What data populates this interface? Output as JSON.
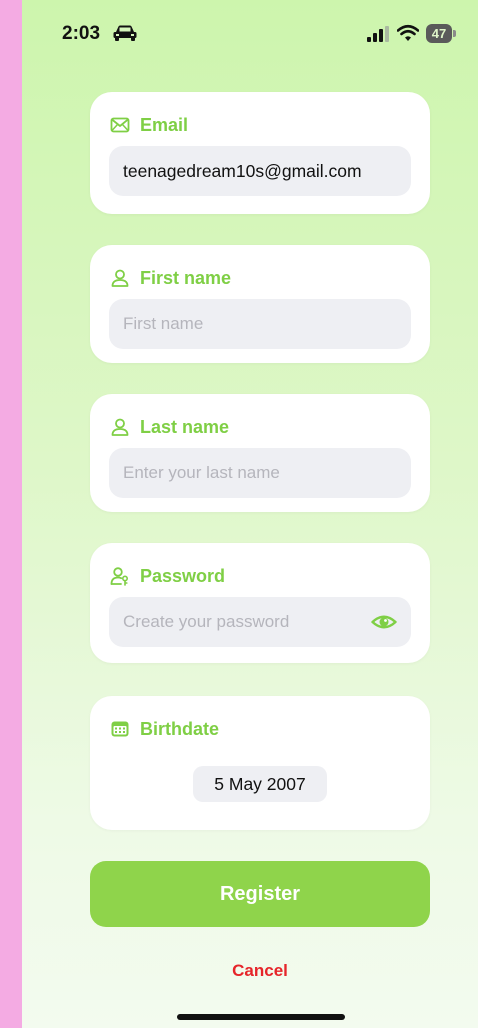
{
  "status_bar": {
    "time": "2:03",
    "battery": "47",
    "icons": [
      "car-icon",
      "signal-icon",
      "wifi-icon",
      "battery-icon"
    ]
  },
  "form": {
    "email": {
      "label": "Email",
      "value": "teenagedream10s@gmail.com",
      "icon": "envelope-icon"
    },
    "first_name": {
      "label": "First name",
      "placeholder": "First name",
      "icon": "person-icon"
    },
    "last_name": {
      "label": "Last name",
      "placeholder": "Enter your last name",
      "icon": "person-icon"
    },
    "password": {
      "label": "Password",
      "placeholder": "Create your password",
      "icon": "person-key-icon",
      "toggle_icon": "eye-icon"
    },
    "birthdate": {
      "label": "Birthdate",
      "value": "5 May 2007",
      "icon": "calendar-icon"
    }
  },
  "actions": {
    "register_label": "Register",
    "cancel_label": "Cancel"
  },
  "colors": {
    "accent_green": "#7fcf45",
    "register_button": "#8fd44b",
    "cancel_red": "#e6252a",
    "field_background": "#eeeff3",
    "outer_background": "#f4abe3"
  }
}
